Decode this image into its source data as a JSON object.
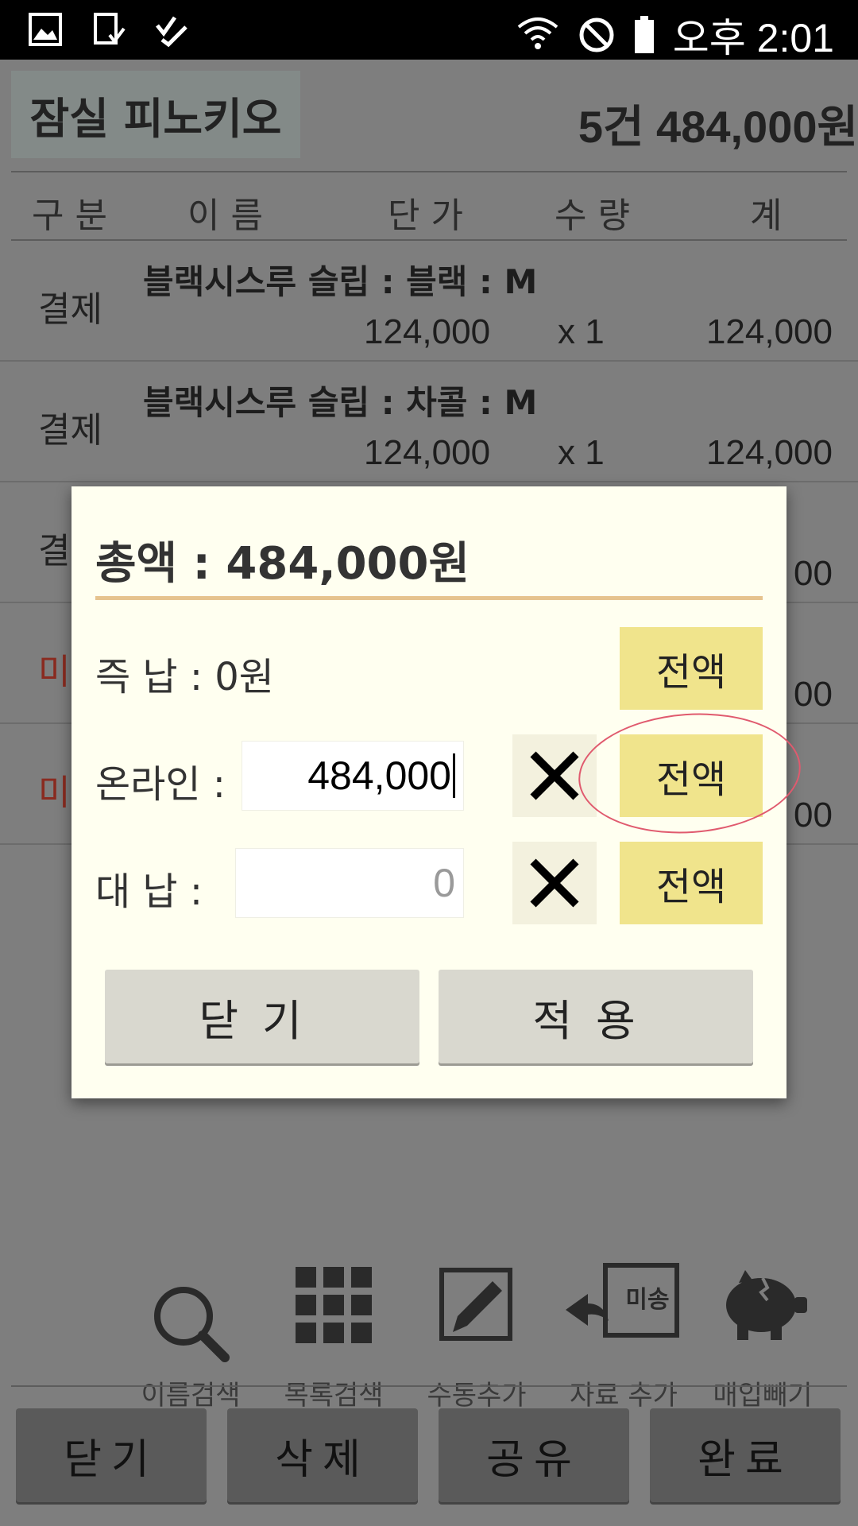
{
  "status_bar": {
    "time": "오후 2:01",
    "left_icons": [
      "gallery-icon",
      "screenshot-icon",
      "task-check-icon"
    ],
    "right_icons": [
      "wifi-icon",
      "do-not-disturb-icon",
      "battery-icon"
    ]
  },
  "header": {
    "store_name": "잠실 피노키오",
    "summary": "5건 484,000원"
  },
  "table": {
    "columns": [
      "구분",
      "이름",
      "단가",
      "수량",
      "계"
    ],
    "rows": [
      {
        "kind": "결제",
        "name": "블랙시스루 슬립 : 블랙 : M",
        "price": "124,000",
        "qty": "x 1",
        "total": "124,000"
      },
      {
        "kind": "결제",
        "name": "블랙시스루 슬립 : 차콜 : M",
        "price": "124,000",
        "qty": "x 1",
        "total": "124,000"
      },
      {
        "kind": "결",
        "name": "",
        "price": "",
        "qty": "",
        "total": "00"
      },
      {
        "kind": "미",
        "name": "",
        "price": "",
        "qty": "",
        "total": "00"
      },
      {
        "kind": "미",
        "name": "",
        "price": "",
        "qty": "",
        "total": "00"
      }
    ]
  },
  "dialog": {
    "title": "총액 : 484,000원",
    "cash_label": "즉  납 : 0원",
    "online_label": "온라인 :",
    "online_value": "484,000",
    "proxy_label": "대   납 :",
    "proxy_placeholder": "0",
    "full_amount_label": "전액",
    "close_label": "닫기",
    "apply_label": "적용"
  },
  "toolbar": {
    "items": [
      {
        "label": "이름검색",
        "icon": "search-icon"
      },
      {
        "label": "목록검색",
        "icon": "grid-icon"
      },
      {
        "label": "수동추가",
        "icon": "edit-icon"
      },
      {
        "label": "자료 추가",
        "icon": "unsent-reply-icon",
        "badge": "미송"
      },
      {
        "label": "매입빼기",
        "icon": "piggy-bank-icon"
      }
    ]
  },
  "bottom_buttons": {
    "close": "닫기",
    "delete": "삭제",
    "share": "공유",
    "done": "완료"
  },
  "colors": {
    "full_button": "#f0e48c",
    "title_underline": "#e6c38e",
    "dialog_bg": "#fffff0",
    "annotation": "#e05a6e"
  }
}
